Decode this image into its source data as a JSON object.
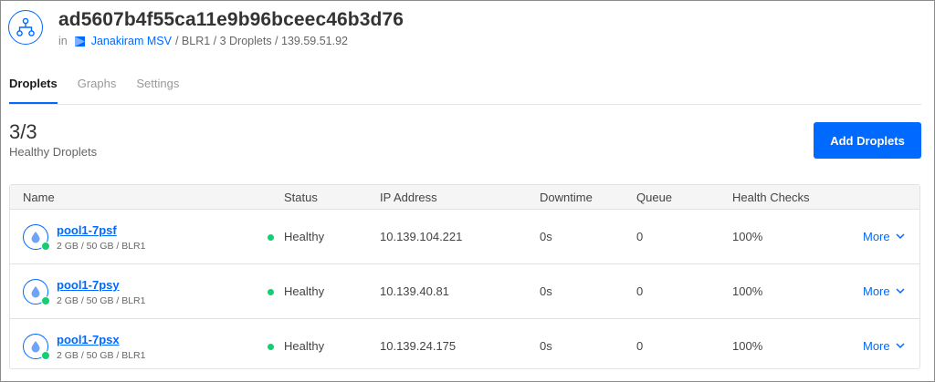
{
  "header": {
    "title": "ad5607b4f55ca11e9b96bceec46b3d76",
    "in_label": "in",
    "project": "Janakiram MSV",
    "path_rest": "/ BLR1 / 3 Droplets / 139.59.51.92"
  },
  "tabs": [
    {
      "label": "Droplets",
      "active": true
    },
    {
      "label": "Graphs",
      "active": false
    },
    {
      "label": "Settings",
      "active": false
    }
  ],
  "summary": {
    "count": "3/3",
    "label": "Healthy Droplets",
    "add_button": "Add Droplets"
  },
  "table": {
    "columns": [
      "Name",
      "Status",
      "IP Address",
      "Downtime",
      "Queue",
      "Health Checks"
    ],
    "rows": [
      {
        "name": "pool1-7psf",
        "meta": "2 GB / 50 GB / BLR1",
        "status": "Healthy",
        "ip": "10.139.104.221",
        "downtime": "0s",
        "queue": "0",
        "health": "100%",
        "more": "More"
      },
      {
        "name": "pool1-7psy",
        "meta": "2 GB / 50 GB / BLR1",
        "status": "Healthy",
        "ip": "10.139.40.81",
        "downtime": "0s",
        "queue": "0",
        "health": "100%",
        "more": "More"
      },
      {
        "name": "pool1-7psx",
        "meta": "2 GB / 50 GB / BLR1",
        "status": "Healthy",
        "ip": "10.139.24.175",
        "downtime": "0s",
        "queue": "0",
        "health": "100%",
        "more": "More"
      }
    ]
  },
  "colors": {
    "accent": "#0069ff",
    "healthy": "#15cd72"
  },
  "icons": {
    "load_balancer": "load-balancer-icon",
    "project": "project-icon",
    "droplet": "droplet-icon",
    "chevron": "chevron-down-icon"
  }
}
